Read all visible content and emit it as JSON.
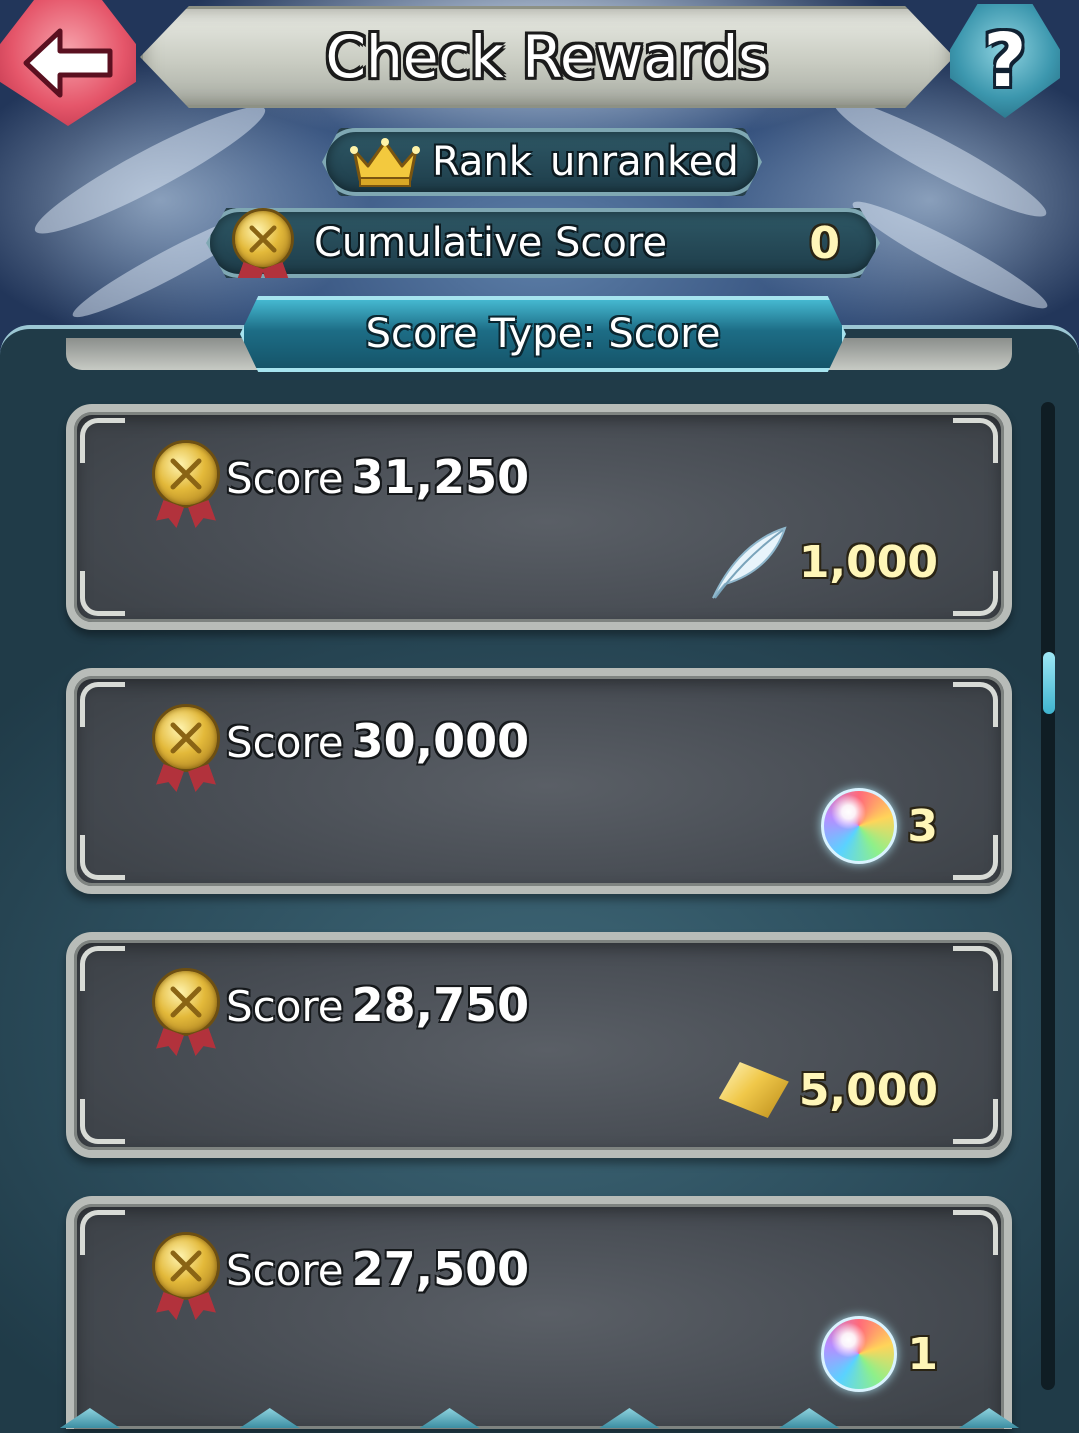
{
  "header": {
    "title": "Check Rewards",
    "back_icon": "back-arrow-icon",
    "help_label": "?"
  },
  "rank": {
    "icon": "crown-icon",
    "label": "Rank",
    "value": "unranked"
  },
  "cumulative": {
    "icon": "medal-icon",
    "label": "Cumulative Score",
    "value": "0"
  },
  "score_type": {
    "label": "Score Type: Score"
  },
  "rewards": [
    {
      "label": "Score",
      "score": "31,250",
      "reward_icon": "feather-icon",
      "reward_amount": "1,000"
    },
    {
      "label": "Score",
      "score": "30,000",
      "reward_icon": "orb-icon",
      "reward_amount": "3"
    },
    {
      "label": "Score",
      "score": "28,750",
      "reward_icon": "crystal-icon",
      "reward_amount": "5,000"
    },
    {
      "label": "Score",
      "score": "27,500",
      "reward_icon": "orb-icon",
      "reward_amount": "1"
    }
  ],
  "colors": {
    "accent_teal": "#45b8d0",
    "back_button": "#e5566a",
    "reward_text": "#fff6b8"
  }
}
